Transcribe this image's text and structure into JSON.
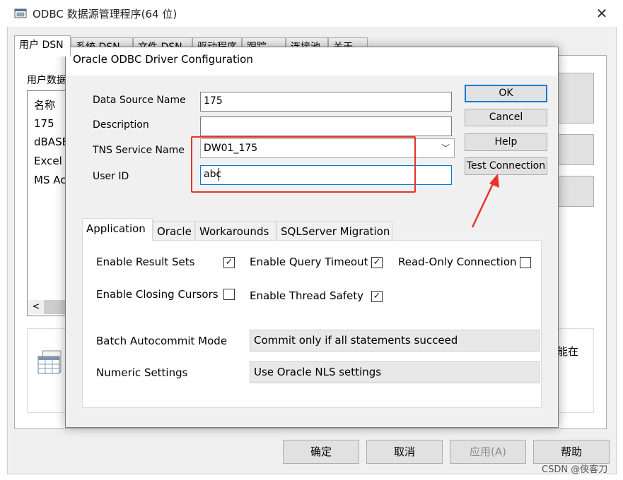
{
  "outer": {
    "title": "ODBC 数据源管理程序(64 位)",
    "close_glyph": "✕",
    "tabs": [
      "用户 DSN",
      "系统 DSN",
      "文件 DSN",
      "驱动程序",
      "跟踪",
      "连接池",
      "关于"
    ],
    "user_ds_label": "用户数据",
    "ds_list": [
      "名称",
      "175",
      "dBASE",
      "Excel F",
      "MS Ac"
    ],
    "scroll_left_glyph": "<",
    "info_text_fragment": "能在",
    "buttons": {
      "ok": "确定",
      "cancel": "取消",
      "apply": "应用(A)",
      "help": "帮助"
    },
    "watermark": "CSDN @侠客刀"
  },
  "dialog": {
    "title": "Oracle ODBC Driver Configuration",
    "fields": {
      "dsn_label": "Data Source Name",
      "dsn_value": "175",
      "desc_label": "Description",
      "desc_value": "",
      "tns_label": "TNS Service Name",
      "tns_value": "DW01_175",
      "userid_label": "User ID",
      "userid_value": "abc"
    },
    "buttons": {
      "ok": "OK",
      "cancel": "Cancel",
      "help": "Help",
      "test": "Test Connection"
    },
    "tabs": [
      "Application",
      "Oracle",
      "Workarounds",
      "SQLServer Migration"
    ],
    "options": {
      "result_sets": {
        "label": "Enable Result Sets",
        "checked": true
      },
      "query_timeout": {
        "label": "Enable Query Timeout",
        "checked": true
      },
      "read_only": {
        "label": "Read-Only Connection",
        "checked": false
      },
      "closing_cursors": {
        "label": "Enable Closing Cursors",
        "checked": false
      },
      "thread_safety": {
        "label": "Enable Thread Safety",
        "checked": true
      }
    },
    "batch_label": "Batch Autocommit Mode",
    "batch_value": "Commit only if all statements succeed",
    "numeric_label": "Numeric Settings",
    "numeric_value": "Use Oracle NLS settings"
  },
  "colors": {
    "accent": "#0078d7",
    "annotation_red": "#e8322c"
  },
  "icons": [
    "app-icon",
    "close-icon",
    "chevron-down-icon",
    "database-icon",
    "annotation-arrow"
  ]
}
